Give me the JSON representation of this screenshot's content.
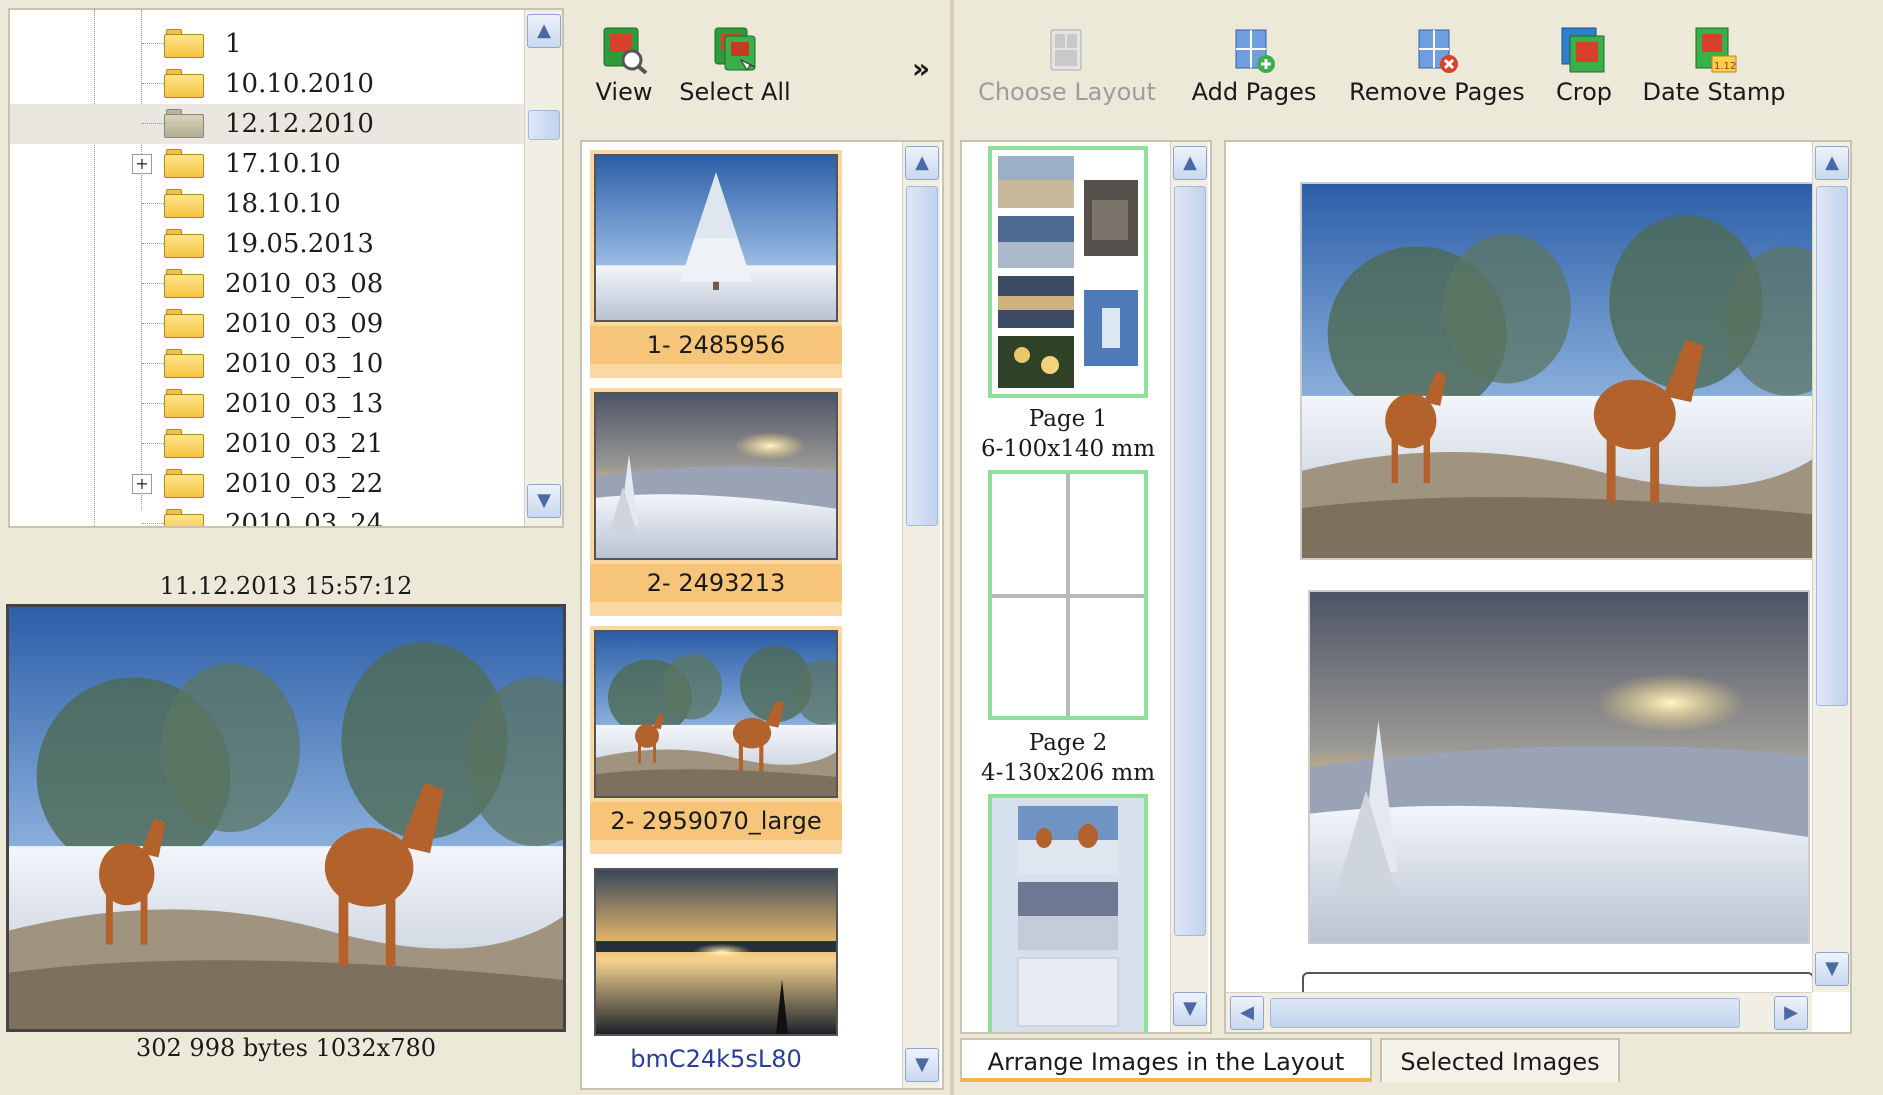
{
  "folder_tree": {
    "items": [
      {
        "label": "1",
        "selected": false,
        "expandable": false
      },
      {
        "label": "10.10.2010",
        "selected": false,
        "expandable": false
      },
      {
        "label": "12.12.2010",
        "selected": true,
        "expandable": false
      },
      {
        "label": "17.10.10",
        "selected": false,
        "expandable": true
      },
      {
        "label": "18.10.10",
        "selected": false,
        "expandable": false
      },
      {
        "label": "19.05.2013",
        "selected": false,
        "expandable": false
      },
      {
        "label": "2010_03_08",
        "selected": false,
        "expandable": false
      },
      {
        "label": "2010_03_09",
        "selected": false,
        "expandable": false
      },
      {
        "label": "2010_03_10",
        "selected": false,
        "expandable": false
      },
      {
        "label": "2010_03_13",
        "selected": false,
        "expandable": false
      },
      {
        "label": "2010_03_21",
        "selected": false,
        "expandable": false
      },
      {
        "label": "2010_03_22",
        "selected": false,
        "expandable": true
      },
      {
        "label": "2010_03_24",
        "selected": false,
        "expandable": false
      }
    ]
  },
  "preview": {
    "date": "11.12.2013 15:57:12",
    "info": "302 998 bytes 1032x780"
  },
  "thumb_toolbar": {
    "view_label": "View",
    "select_all_label": "Select All",
    "more_label": "»"
  },
  "thumbnails": [
    {
      "caption": "1- 2485956",
      "selected": true
    },
    {
      "caption": "2- 2493213",
      "selected": true
    },
    {
      "caption": "2- 2959070_large",
      "selected": true
    },
    {
      "caption": "bmC24k5sL80",
      "selected": false
    }
  ],
  "layout_toolbar": {
    "choose_layout_label": "Choose Layout",
    "add_pages_label": "Add Pages",
    "remove_pages_label": "Remove Pages",
    "crop_label": "Crop",
    "date_stamp_label": "Date Stamp"
  },
  "pages": [
    {
      "title": "Page 1",
      "size": "6-100x140 mm"
    },
    {
      "title": "Page 2",
      "size": "4-130x206 mm"
    }
  ],
  "tabs": {
    "arrange_label": "Arrange Images in the Layout",
    "selected_label": "Selected Images"
  },
  "colors": {
    "selection": "#f7c57a",
    "page_border": "#8fe098",
    "scroll_accent": "#8ea6cf"
  }
}
